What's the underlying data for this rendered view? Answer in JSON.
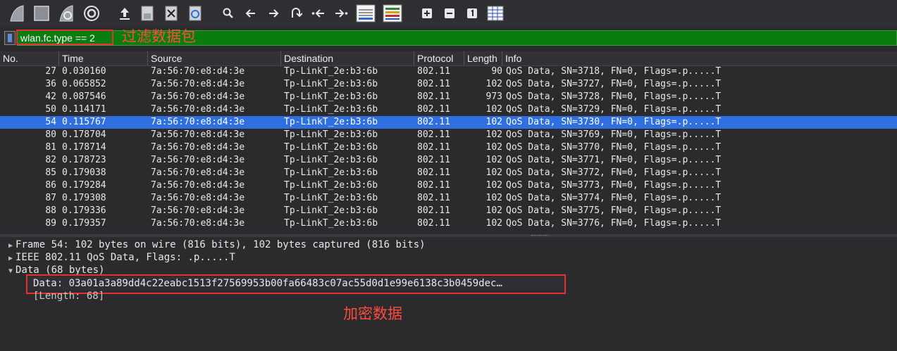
{
  "toolbar": {
    "icons": [
      "shark-fin-start-icon",
      "stop-square-icon",
      "shark-fin-restart-icon",
      "gear-options-icon",
      "open-file-icon",
      "save-file-icon",
      "close-file-icon",
      "reload-file-icon",
      "search-icon",
      "go-back-icon",
      "go-forward-icon",
      "go-to-packet-icon",
      "first-packet-icon",
      "last-packet-icon",
      "autoscroll-icon",
      "colorize-icon",
      "zoom-in-icon",
      "zoom-out-icon",
      "normal-size-icon",
      "resize-columns-icon"
    ]
  },
  "filter": {
    "value": "wlan.fc.type == 2",
    "annotation": "过滤数据包"
  },
  "columns": [
    "No.",
    "Time",
    "Source",
    "Destination",
    "Protocol",
    "Length",
    "Info"
  ],
  "packets": [
    {
      "no": "27",
      "time": "0.030160",
      "src": "7a:56:70:e8:d4:3e",
      "dst": "Tp-LinkT_2e:b3:6b",
      "proto": "802.11",
      "len": "90",
      "info": "QoS Data, SN=3718, FN=0, Flags=.p.....T"
    },
    {
      "no": "36",
      "time": "0.065852",
      "src": "7a:56:70:e8:d4:3e",
      "dst": "Tp-LinkT_2e:b3:6b",
      "proto": "802.11",
      "len": "102",
      "info": "QoS Data, SN=3727, FN=0, Flags=.p.....T"
    },
    {
      "no": "42",
      "time": "0.087546",
      "src": "7a:56:70:e8:d4:3e",
      "dst": "Tp-LinkT_2e:b3:6b",
      "proto": "802.11",
      "len": "973",
      "info": "QoS Data, SN=3728, FN=0, Flags=.p.....T"
    },
    {
      "no": "50",
      "time": "0.114171",
      "src": "7a:56:70:e8:d4:3e",
      "dst": "Tp-LinkT_2e:b3:6b",
      "proto": "802.11",
      "len": "102",
      "info": "QoS Data, SN=3729, FN=0, Flags=.p.....T"
    },
    {
      "no": "54",
      "time": "0.115767",
      "src": "7a:56:70:e8:d4:3e",
      "dst": "Tp-LinkT_2e:b3:6b",
      "proto": "802.11",
      "len": "102",
      "info": "QoS Data, SN=3730, FN=0, Flags=.p.....T"
    },
    {
      "no": "80",
      "time": "0.178704",
      "src": "7a:56:70:e8:d4:3e",
      "dst": "Tp-LinkT_2e:b3:6b",
      "proto": "802.11",
      "len": "102",
      "info": "QoS Data, SN=3769, FN=0, Flags=.p.....T"
    },
    {
      "no": "81",
      "time": "0.178714",
      "src": "7a:56:70:e8:d4:3e",
      "dst": "Tp-LinkT_2e:b3:6b",
      "proto": "802.11",
      "len": "102",
      "info": "QoS Data, SN=3770, FN=0, Flags=.p.....T"
    },
    {
      "no": "82",
      "time": "0.178723",
      "src": "7a:56:70:e8:d4:3e",
      "dst": "Tp-LinkT_2e:b3:6b",
      "proto": "802.11",
      "len": "102",
      "info": "QoS Data, SN=3771, FN=0, Flags=.p.....T"
    },
    {
      "no": "85",
      "time": "0.179038",
      "src": "7a:56:70:e8:d4:3e",
      "dst": "Tp-LinkT_2e:b3:6b",
      "proto": "802.11",
      "len": "102",
      "info": "QoS Data, SN=3772, FN=0, Flags=.p.....T"
    },
    {
      "no": "86",
      "time": "0.179284",
      "src": "7a:56:70:e8:d4:3e",
      "dst": "Tp-LinkT_2e:b3:6b",
      "proto": "802.11",
      "len": "102",
      "info": "QoS Data, SN=3773, FN=0, Flags=.p.....T"
    },
    {
      "no": "87",
      "time": "0.179308",
      "src": "7a:56:70:e8:d4:3e",
      "dst": "Tp-LinkT_2e:b3:6b",
      "proto": "802.11",
      "len": "102",
      "info": "QoS Data, SN=3774, FN=0, Flags=.p.....T"
    },
    {
      "no": "88",
      "time": "0.179336",
      "src": "7a:56:70:e8:d4:3e",
      "dst": "Tp-LinkT_2e:b3:6b",
      "proto": "802.11",
      "len": "102",
      "info": "QoS Data, SN=3775, FN=0, Flags=.p.....T"
    },
    {
      "no": "89",
      "time": "0.179357",
      "src": "7a:56:70:e8:d4:3e",
      "dst": "Tp-LinkT_2e:b3:6b",
      "proto": "802.11",
      "len": "102",
      "info": "QoS Data, SN=3776, FN=0, Flags=.p.....T"
    }
  ],
  "selected_index": 4,
  "details": {
    "frame": "Frame 54: 102 bytes on wire (816 bits), 102 bytes captured (816 bits)",
    "ieee": "IEEE 802.11 QoS Data, Flags: .p.....T",
    "data": "Data (68 bytes)",
    "data_value": "Data: 03a01a3a89dd4c22eabc1513f27569953b00fa66483c07ac55d0d1e99e6138c3b0459dec…",
    "length": "[Length: 68]"
  },
  "data_annotation": "加密数据",
  "colors": {
    "filter_bg": "#0a7d10",
    "selection": "#2f6fe0",
    "annotation": "#e8312f"
  }
}
